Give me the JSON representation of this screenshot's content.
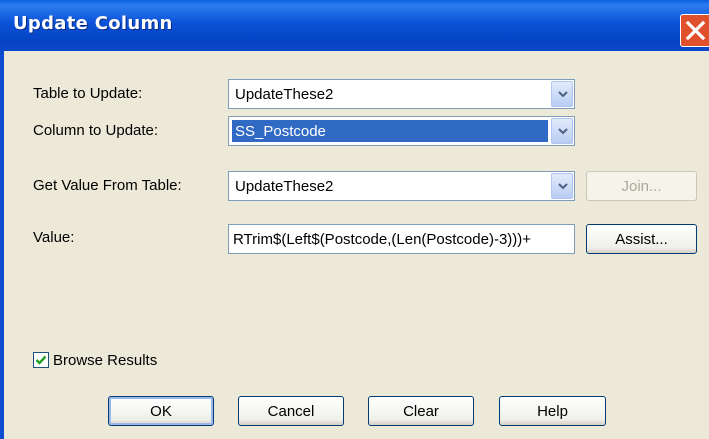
{
  "window": {
    "title": "Update Column"
  },
  "fields": {
    "table_label": "Table to Update:",
    "table_value": "UpdateThese2",
    "column_label": "Column to Update:",
    "column_value": "SS_Postcode",
    "from_label": "Get Value From Table:",
    "from_value": "UpdateThese2",
    "value_label": "Value:",
    "value_text": "RTrim$(Left$(Postcode,(Len(Postcode)-3)))+"
  },
  "buttons": {
    "join": "Join...",
    "assist": "Assist...",
    "ok": "OK",
    "cancel": "Cancel",
    "clear": "Clear",
    "help": "Help"
  },
  "options": {
    "browse_results_label": "Browse Results",
    "browse_results_checked": true
  },
  "icons": {
    "close": "close-icon",
    "dropdown": "chevron-down-icon",
    "check": "checkmark-icon"
  },
  "colors": {
    "titlebar": "#0a4fd6",
    "selection": "#316ac5",
    "dialog_bg": "#ece9d8",
    "close": "#e0502c"
  }
}
